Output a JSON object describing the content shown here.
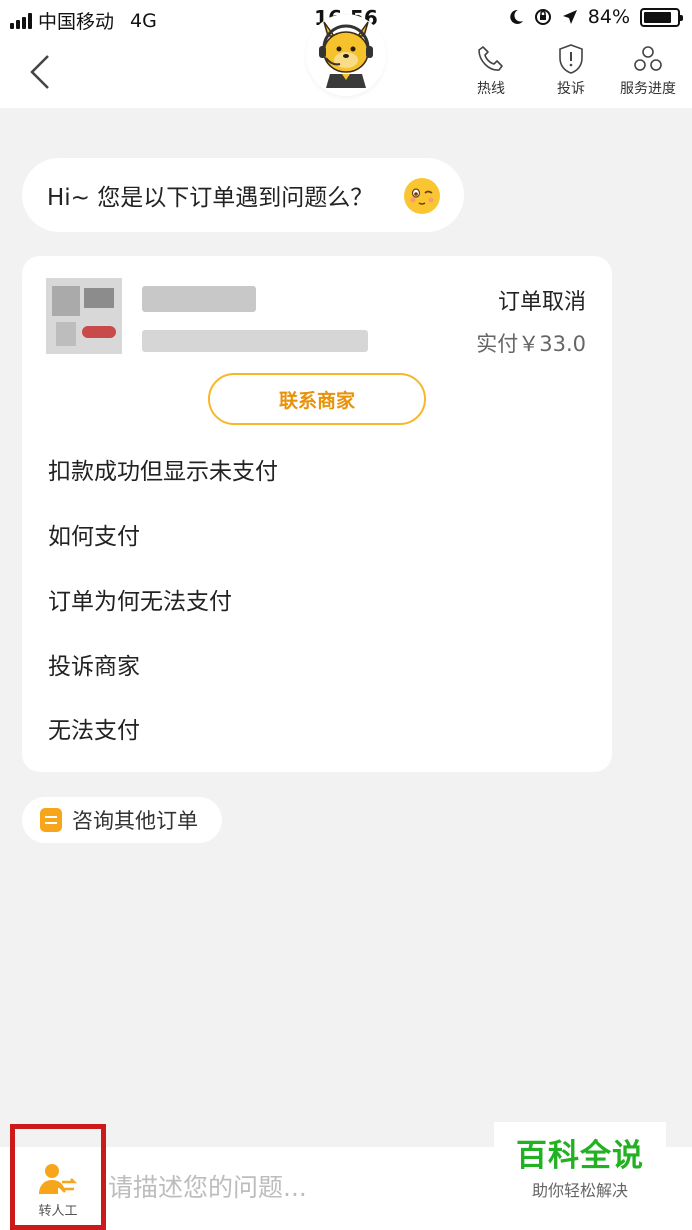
{
  "status_bar": {
    "carrier": "中国移动",
    "network": "4G",
    "time": "16:56",
    "battery": "84%",
    "battery_level": 0.84
  },
  "header": {
    "actions": [
      {
        "label": "热线",
        "icon": "phone-icon"
      },
      {
        "label": "投诉",
        "icon": "shield-alert-icon"
      },
      {
        "label": "服务进度",
        "icon": "progress-icon"
      }
    ]
  },
  "chat": {
    "greeting": "Hi~ 您是以下订单遇到问题么？"
  },
  "order": {
    "status": "订单取消",
    "paid": "实付￥33.0",
    "contact_label": "联系商家",
    "faqs": [
      "扣款成功但显示未支付",
      "如何支付",
      "订单为何无法支付",
      "投诉商家",
      "无法支付"
    ]
  },
  "other_orders_label": "咨询其他订单",
  "bottom": {
    "transfer_label": "转人工",
    "input_placeholder": "请描述您的问题..."
  },
  "watermark": {
    "title": "百科全说",
    "subtitle": "助你轻松解决"
  },
  "colors": {
    "accent": "#f7b728",
    "accent_text": "#e8920a",
    "background": "#f2f2f2",
    "highlight_box": "#cc1a1a",
    "watermark_green": "#22b122"
  }
}
